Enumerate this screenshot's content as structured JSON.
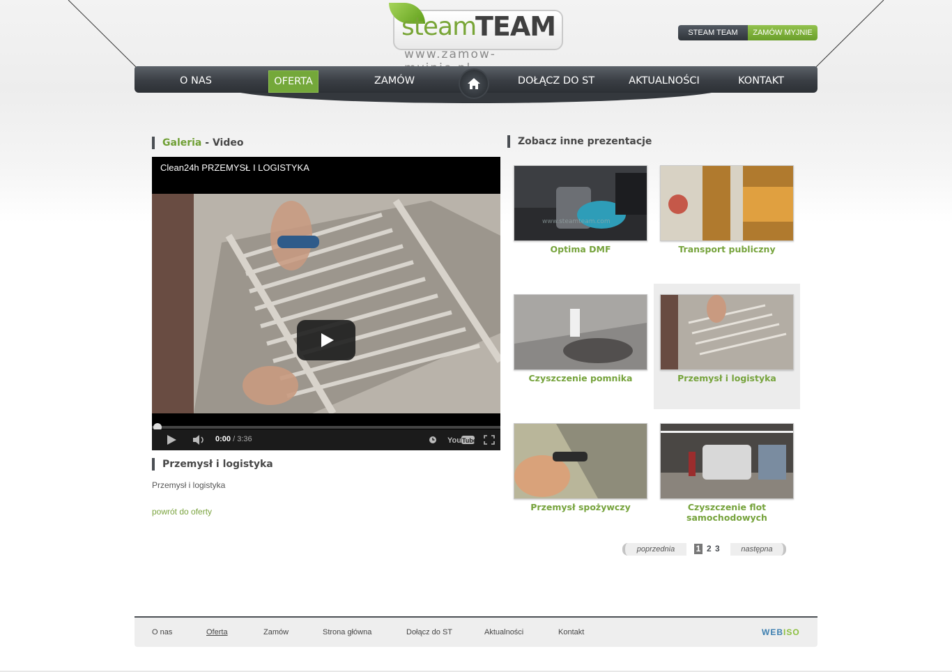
{
  "brand": {
    "steam": "steam",
    "team": "TEAM",
    "url": "www.zamow-myjnie.pl"
  },
  "top_links": {
    "steam_team": "STEAM TEAM",
    "zamow_myjnie": "ZAMÓW MYJNIE"
  },
  "nav": {
    "o_nas": "O NAS",
    "oferta": "OFERTA",
    "zamow": "ZAMÓW",
    "dolacz": "DOŁĄCZ DO ST",
    "aktualnosci": "AKTUALNOŚCI",
    "kontakt": "KONTAKT",
    "active": "oferta"
  },
  "gallery": {
    "title_green": "Galeria",
    "title_dash": " - ",
    "title_rest": "Video"
  },
  "video": {
    "title": "Clean24h PRZEMYSŁ I LOGISTYKA",
    "current_time": "0:00",
    "separator": " / ",
    "duration": "3:36",
    "progress": 0
  },
  "item": {
    "heading": "Przemysł i logistyka",
    "description": "Przemysł i logistyka",
    "back_link": "powrót do oferty"
  },
  "others": {
    "heading": "Zobacz inne prezentacje",
    "thumbs": [
      {
        "label": "Optima DMF",
        "watermark": "www.steamteam.com"
      },
      {
        "label": "Transport publiczny"
      },
      {
        "label": "Czyszczenie pomnika"
      },
      {
        "label": "Przemysł i logistyka",
        "selected": true
      },
      {
        "label": "Przemysł spożywczy"
      },
      {
        "label": "Czyszczenie flot samochodowych"
      }
    ]
  },
  "pager": {
    "prev": "poprzednia",
    "next": "następna",
    "pages": [
      "1",
      "2",
      "3"
    ],
    "current": "1"
  },
  "footer": {
    "links": [
      "O nas",
      "Oferta",
      "Zamów",
      "Strona główna",
      "Dołącz do ST",
      "Aktualności",
      "Kontakt"
    ],
    "current": "Oferta",
    "credit_a": "WEB",
    "credit_b": "ISO"
  },
  "colors": {
    "accent_green": "#74a83a",
    "nav_dark": "#3a3e44",
    "link_green": "#76a33c"
  }
}
